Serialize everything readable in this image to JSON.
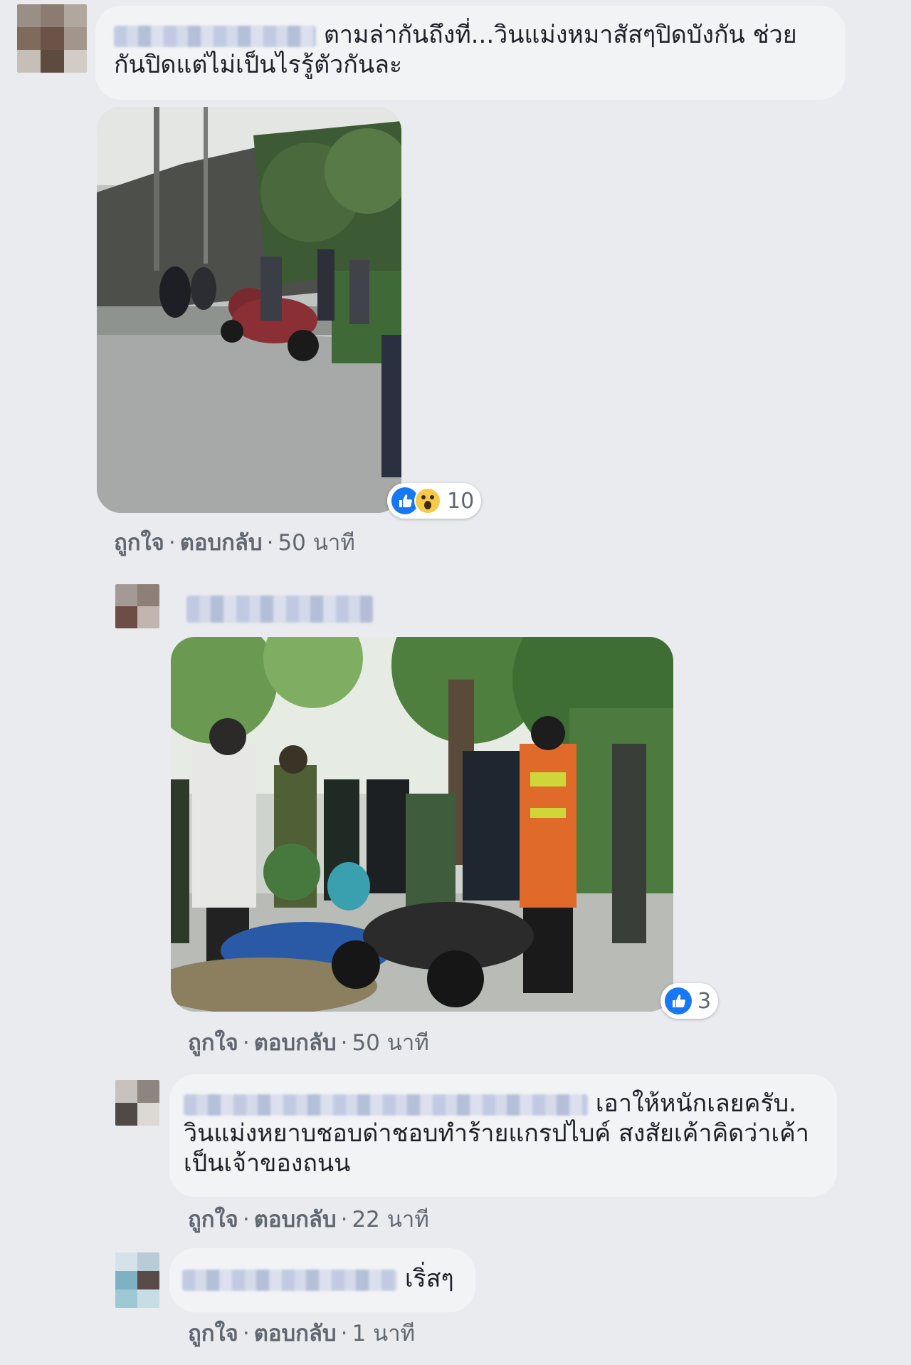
{
  "colors": {
    "page_bg": "#e9ebee",
    "bubble_bg": "#f2f3f5",
    "action_text": "#606770",
    "like_blue": "#1877f2",
    "wow_yellow": "#f7c948"
  },
  "comments": [
    {
      "text": "ตามล่ากันถึงที่...วินแม่งหมาสัสๆปิดบังกัน ช่วยกันปิดแต่ไม่เป็นไรรู้ตัวกันละ",
      "reactions": {
        "icons": [
          "like-icon",
          "wow-icon"
        ],
        "count": "10"
      },
      "actions": {
        "like": "ถูกใจ",
        "reply": "ตอบกลับ",
        "time": "50 นาที"
      }
    },
    {
      "reactions": {
        "icons": [
          "like-icon"
        ],
        "count": "3"
      },
      "actions": {
        "like": "ถูกใจ",
        "reply": "ตอบกลับ",
        "time": "50 นาที"
      }
    },
    {
      "text": "เอาให้หนักเลยครับ. วินแม่งหยาบชอบด่าชอบทำร้ายแกรปไบค์ สงสัยเค้าคิดว่าเค้าเป็นเจ้าของถนน",
      "actions": {
        "like": "ถูกใจ",
        "reply": "ตอบกลับ",
        "time": "22 นาที"
      }
    },
    {
      "text": "เริ่สๆ",
      "actions": {
        "like": "ถูกใจ",
        "reply": "ตอบกลับ",
        "time": "1 นาที"
      }
    }
  ],
  "separator": "·"
}
